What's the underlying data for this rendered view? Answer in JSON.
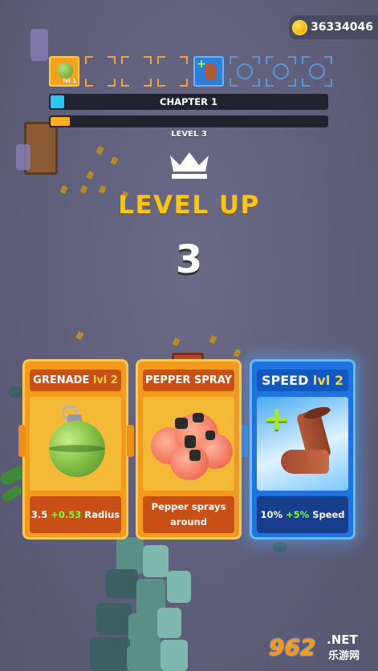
{
  "hud": {
    "coins": "36334046"
  },
  "slots": [
    {
      "type": "grenade",
      "level_label": "lvl 1",
      "icon": "grenade-icon"
    },
    {
      "type": "empty"
    },
    {
      "type": "empty"
    },
    {
      "type": "empty"
    },
    {
      "type": "boot",
      "icon": "speed-boot-icon"
    },
    {
      "type": "empty-blue"
    },
    {
      "type": "empty-blue"
    },
    {
      "type": "empty-blue"
    }
  ],
  "progress": {
    "chapter_label": "CHAPTER 1",
    "chapter_fraction": 0.05,
    "level_fraction": 0.07,
    "level_label": "LEVEL 3"
  },
  "level_up": {
    "title": "LEVEL UP",
    "number": "3"
  },
  "cards": [
    {
      "name": "GRENADE",
      "level": "lvl 2",
      "desc_base": "3.5",
      "desc_bonus": "+0.53",
      "desc_unit": "Radius",
      "color": "#f39a1a"
    },
    {
      "name": "PEPPER SPRAY",
      "desc_line1": "Pepper sprays",
      "desc_line2": "around",
      "color": "#f39a1a"
    },
    {
      "name": "SPEED",
      "level": "lvl 2",
      "desc_base": "10%",
      "desc_bonus": "+5%",
      "desc_unit": "Speed",
      "color": "#1f73e0"
    }
  ],
  "watermark": {
    "logo": "962",
    "net": ".NET",
    "cn": "乐游网"
  }
}
